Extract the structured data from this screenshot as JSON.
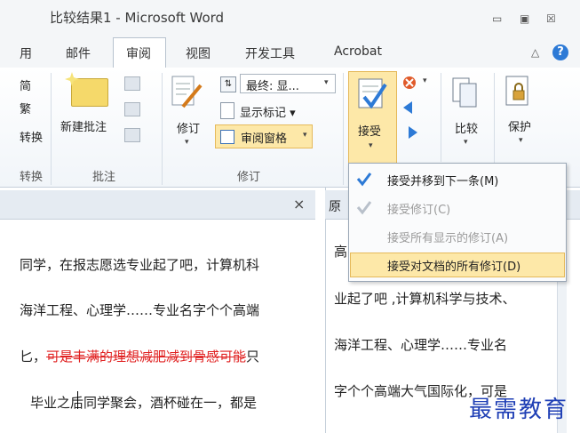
{
  "window": {
    "title": "比较结果1 - Microsoft Word",
    "minimize_glyph": "▭",
    "restore_glyph": "▣",
    "close_glyph": "☒"
  },
  "tabs": [
    {
      "label": "用"
    },
    {
      "label": "邮件"
    },
    {
      "label": "审阅",
      "selected": true
    },
    {
      "label": "视图"
    },
    {
      "label": "开发工具"
    },
    {
      "label": "Acrobat"
    }
  ],
  "ribbon_controls": {
    "collapse_glyph": "△",
    "help_glyph": "?"
  },
  "ribbon": {
    "convert_group": {
      "items": [
        "简",
        "繁",
        "转换"
      ],
      "label": "转换"
    },
    "comments_group": {
      "new_comment": "新建批注",
      "label": "批注"
    },
    "tracking_group": {
      "track_changes": "修订",
      "final_show": "最终: 显...",
      "show_markup": "显示标记 ▾",
      "reviewing_pane": "审阅窗格",
      "label": "修订"
    },
    "changes_group": {
      "accept": "接受",
      "compare": "比较",
      "protect": "保护"
    }
  },
  "accept_menu": {
    "items": [
      {
        "label": "接受并移到下一条(M)",
        "enabled": true
      },
      {
        "label": "接受修订(C)",
        "enabled": false
      },
      {
        "label": "接受所有显示的修订(A)",
        "enabled": false
      },
      {
        "label": "接受对文档的所有修订(D)",
        "enabled": true,
        "highlighted": true
      }
    ]
  },
  "document": {
    "close_glyph": "×",
    "lines": [
      "同学，在报志愿选专业起了吧，计算机科",
      "海洋工程、心理学……专业名字个个高端",
      "匕，",
      "可是丰满的理想减肥减到骨感可能",
      "只",
      "毕业之后同学聚会，酒杯碰在一，都是"
    ]
  },
  "source_pane": {
    "header": "原",
    "lines": [
      "高",
      "业起了吧 ,计算机科学与技术、",
      "海洋工程、心理学……专业名",
      "字个个高端大气国际化，可是"
    ]
  },
  "watermark": "最需教育",
  "colors": {
    "accent_blue": "#2d7ad6",
    "highlight": "#fde8a8",
    "deleted_text": "#e02020"
  }
}
